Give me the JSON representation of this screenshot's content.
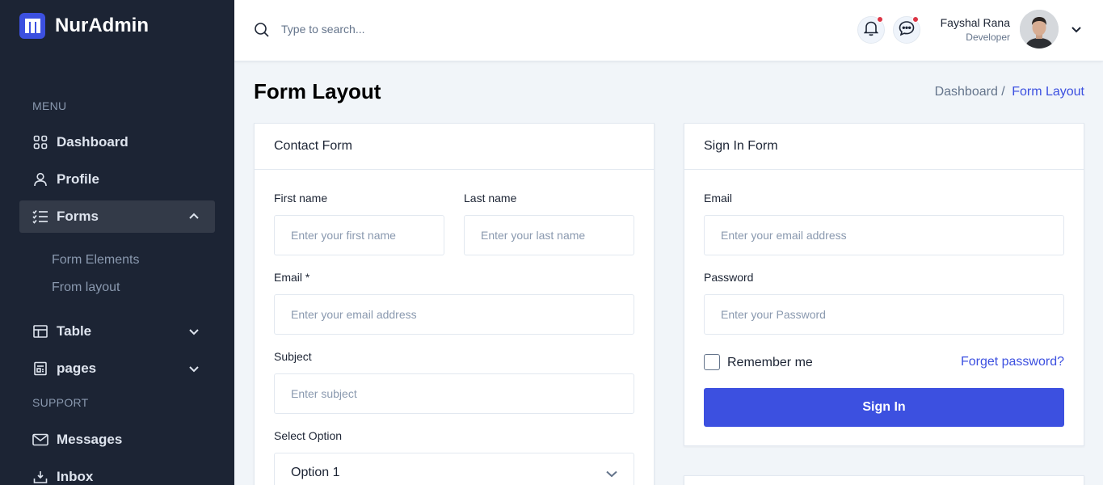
{
  "brand": {
    "name": "NurAdmin"
  },
  "sidebar": {
    "menu_heading": "MENU",
    "items": [
      {
        "label": "Dashboard",
        "icon": "grid-icon"
      },
      {
        "label": "Profile",
        "icon": "user-icon"
      },
      {
        "label": "Forms",
        "icon": "list-check-icon",
        "expanded": true,
        "active": true
      },
      {
        "label": "Table",
        "icon": "table-icon"
      },
      {
        "label": "pages",
        "icon": "page-icon"
      }
    ],
    "forms_sub": [
      "Form Elements",
      "From layout"
    ],
    "support_heading": "SUPPORT",
    "support_items": [
      {
        "label": "Messages",
        "icon": "mail-icon"
      },
      {
        "label": "Inbox",
        "icon": "inbox-icon"
      }
    ]
  },
  "header": {
    "search_placeholder": "Type to search...",
    "user": {
      "name": "Fayshal Rana",
      "role": "Developer"
    }
  },
  "page": {
    "title": "Form Layout",
    "breadcrumb": {
      "parent": "Dashboard /",
      "current": "Form Layout"
    }
  },
  "contact_form": {
    "title": "Contact Form",
    "first_name_label": "First name",
    "first_name_placeholder": "Enter your first name",
    "last_name_label": "Last name",
    "last_name_placeholder": "Enter your last name",
    "email_label": "Email *",
    "email_placeholder": "Enter your email address",
    "subject_label": "Subject",
    "subject_placeholder": "Enter subject",
    "select_label": "Select Option",
    "select_value": "Option 1"
  },
  "signin_form": {
    "title": "Sign In Form",
    "email_label": "Email",
    "email_placeholder": "Enter your email address",
    "password_label": "Password",
    "password_placeholder": "Enter your Password",
    "remember_label": "Remember me",
    "forgot_label": "Forget password?",
    "submit_label": "Sign In"
  },
  "colors": {
    "sidebar_bg": "#1c2434",
    "primary": "#3c50e0",
    "page_bg": "#f1f5f9",
    "notification_dot": "#dc3545"
  }
}
